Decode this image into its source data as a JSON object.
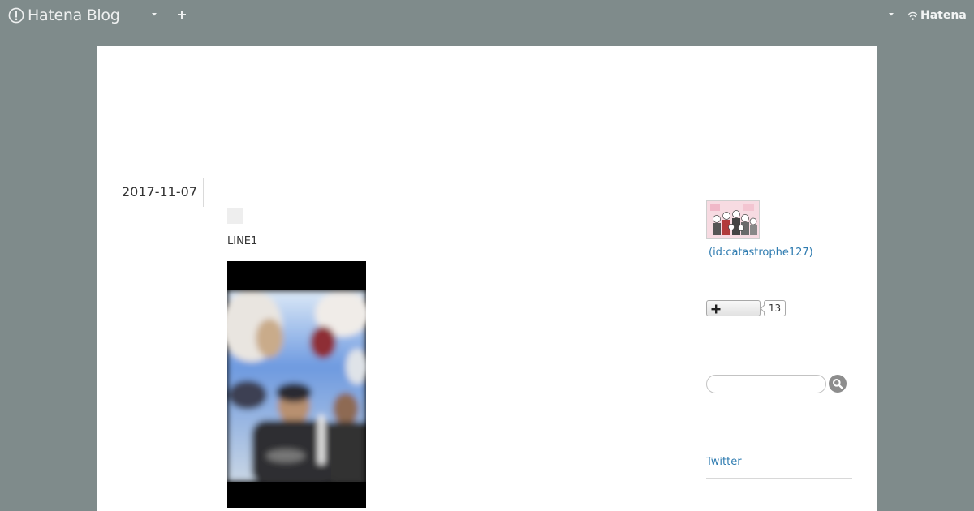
{
  "globalbar": {
    "brand_label": "Hatena Blog",
    "menu_caret_icon": "caret-down-icon",
    "new_post_icon": "plus-icon",
    "account_caret_icon": "caret-down-icon",
    "hatena_label": "Hatena"
  },
  "entry": {
    "date": "2017-11-07",
    "body_text": "LINE1",
    "photo_icon": "photo-image"
  },
  "sidebar": {
    "profile": {
      "user_id": "(id:catastrophe127)"
    },
    "subscribe": {
      "icon": "plus-icon",
      "count": "13"
    },
    "search": {
      "placeholder": "",
      "icon": "search-icon"
    },
    "twitter_label": "Twitter"
  },
  "colors": {
    "page_background": "#7f8b8b",
    "container_background": "#ffffff",
    "link": "#2e7bb0",
    "text": "#333333"
  }
}
